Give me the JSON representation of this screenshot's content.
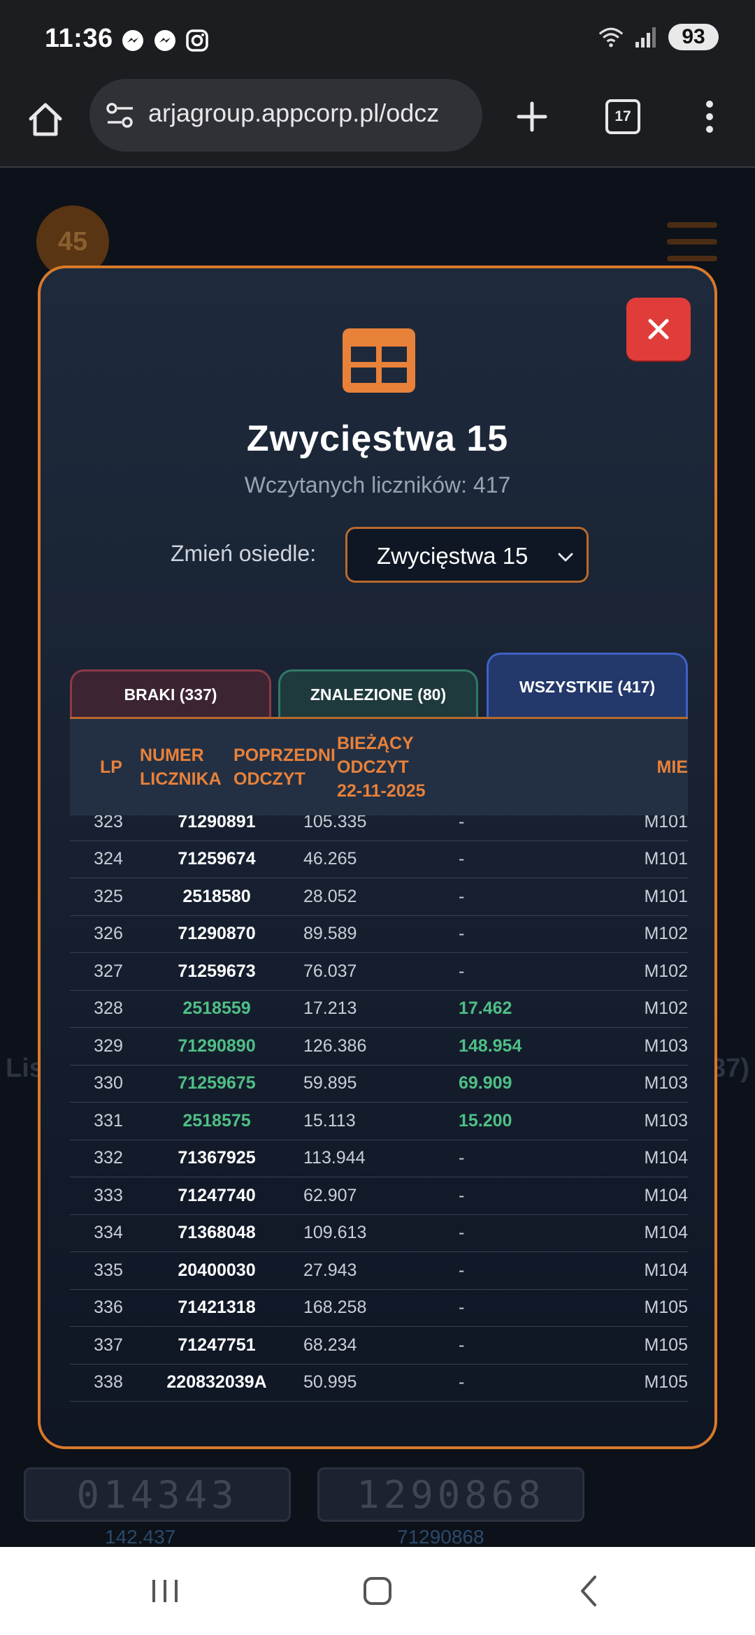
{
  "status_bar": {
    "time": "11:36",
    "battery": "93",
    "icons": [
      "messenger-icon",
      "messenger-icon",
      "instagram-icon",
      "wifi-icon",
      "signal-icon"
    ]
  },
  "browser": {
    "url": "arjagroup.appcorp.pl/odcz",
    "tab_count": "17"
  },
  "background": {
    "badge": "45",
    "left_text": "Lis",
    "right_text": "37)",
    "meter_left": "014343",
    "meter_right": "1290868",
    "meter_left_label": "142.437",
    "meter_right_label": "71290868"
  },
  "modal": {
    "title": "Zwycięstwa 15",
    "subtitle": "Wczytanych liczników: 417",
    "select_label": "Zmień osiedle:",
    "select_value": "Zwycięstwa 15",
    "tabs": [
      {
        "label": "BRAKI (337)"
      },
      {
        "label": "ZNALEZIONE (80)"
      },
      {
        "label": "WSZYSTKIE (417)"
      }
    ],
    "table": {
      "headers": {
        "lp": "LP",
        "numer": "NUMER\nLICZNIKA",
        "poprzedni": "POPRZEDNI\nODCZYT",
        "biezacy": "BIEŻĄCY\nODCZYT\n22-11-2025",
        "mie": "MIE"
      },
      "rows": [
        {
          "lp": "323",
          "numer": "71290891",
          "poprzedni": "105.335",
          "biezacy": "-",
          "mie": "M101",
          "found": false
        },
        {
          "lp": "324",
          "numer": "71259674",
          "poprzedni": "46.265",
          "biezacy": "-",
          "mie": "M101",
          "found": false
        },
        {
          "lp": "325",
          "numer": "2518580",
          "poprzedni": "28.052",
          "biezacy": "-",
          "mie": "M101",
          "found": false
        },
        {
          "lp": "326",
          "numer": "71290870",
          "poprzedni": "89.589",
          "biezacy": "-",
          "mie": "M102",
          "found": false
        },
        {
          "lp": "327",
          "numer": "71259673",
          "poprzedni": "76.037",
          "biezacy": "-",
          "mie": "M102",
          "found": false
        },
        {
          "lp": "328",
          "numer": "2518559",
          "poprzedni": "17.213",
          "biezacy": "17.462",
          "mie": "M102",
          "found": true
        },
        {
          "lp": "329",
          "numer": "71290890",
          "poprzedni": "126.386",
          "biezacy": "148.954",
          "mie": "M103",
          "found": true
        },
        {
          "lp": "330",
          "numer": "71259675",
          "poprzedni": "59.895",
          "biezacy": "69.909",
          "mie": "M103",
          "found": true
        },
        {
          "lp": "331",
          "numer": "2518575",
          "poprzedni": "15.113",
          "biezacy": "15.200",
          "mie": "M103",
          "found": true
        },
        {
          "lp": "332",
          "numer": "71367925",
          "poprzedni": "113.944",
          "biezacy": "-",
          "mie": "M104",
          "found": false
        },
        {
          "lp": "333",
          "numer": "71247740",
          "poprzedni": "62.907",
          "biezacy": "-",
          "mie": "M104",
          "found": false
        },
        {
          "lp": "334",
          "numer": "71368048",
          "poprzedni": "109.613",
          "biezacy": "-",
          "mie": "M104",
          "found": false
        },
        {
          "lp": "335",
          "numer": "20400030",
          "poprzedni": "27.943",
          "biezacy": "-",
          "mie": "M104",
          "found": false
        },
        {
          "lp": "336",
          "numer": "71421318",
          "poprzedni": "168.258",
          "biezacy": "-",
          "mie": "M105",
          "found": false
        },
        {
          "lp": "337",
          "numer": "71247751",
          "poprzedni": "68.234",
          "biezacy": "-",
          "mie": "M105",
          "found": false
        },
        {
          "lp": "338",
          "numer": "220832039A",
          "poprzedni": "50.995",
          "biezacy": "-",
          "mie": "M105",
          "found": false
        }
      ]
    }
  },
  "colors": {
    "accent": "#e8813a",
    "close": "#e03d3a",
    "found": "#4fbf86",
    "tab_braki": "#8a3a47",
    "tab_znalezione": "#2f7a68",
    "tab_wszystkie": "#3f62c6"
  }
}
